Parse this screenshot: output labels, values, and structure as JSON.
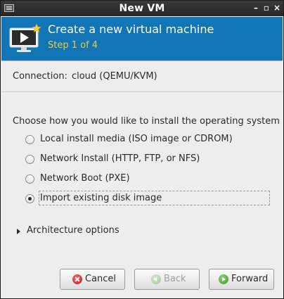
{
  "window": {
    "title": "New VM"
  },
  "banner": {
    "heading": "Create a new virtual machine",
    "step": "Step 1 of 4",
    "icon": "virtual-machine-new-icon",
    "heading_color": "#ffffff",
    "step_color": "#e9c94b",
    "background": "#1175b6"
  },
  "connection": {
    "label": "Connection:",
    "value": "cloud (QEMU/KVM)"
  },
  "install": {
    "prompt": "Choose how you would like to install the operating system",
    "options": [
      {
        "label": "Local install media (ISO image or CDROM)",
        "selected": false
      },
      {
        "label": "Network Install (HTTP, FTP, or NFS)",
        "selected": false
      },
      {
        "label": "Network Boot (PXE)",
        "selected": false
      },
      {
        "label": "Import existing disk image",
        "selected": true
      }
    ]
  },
  "architecture": {
    "label": "Architecture options",
    "expanded": false
  },
  "buttons": {
    "cancel": "Cancel",
    "back": "Back",
    "forward": "Forward"
  }
}
